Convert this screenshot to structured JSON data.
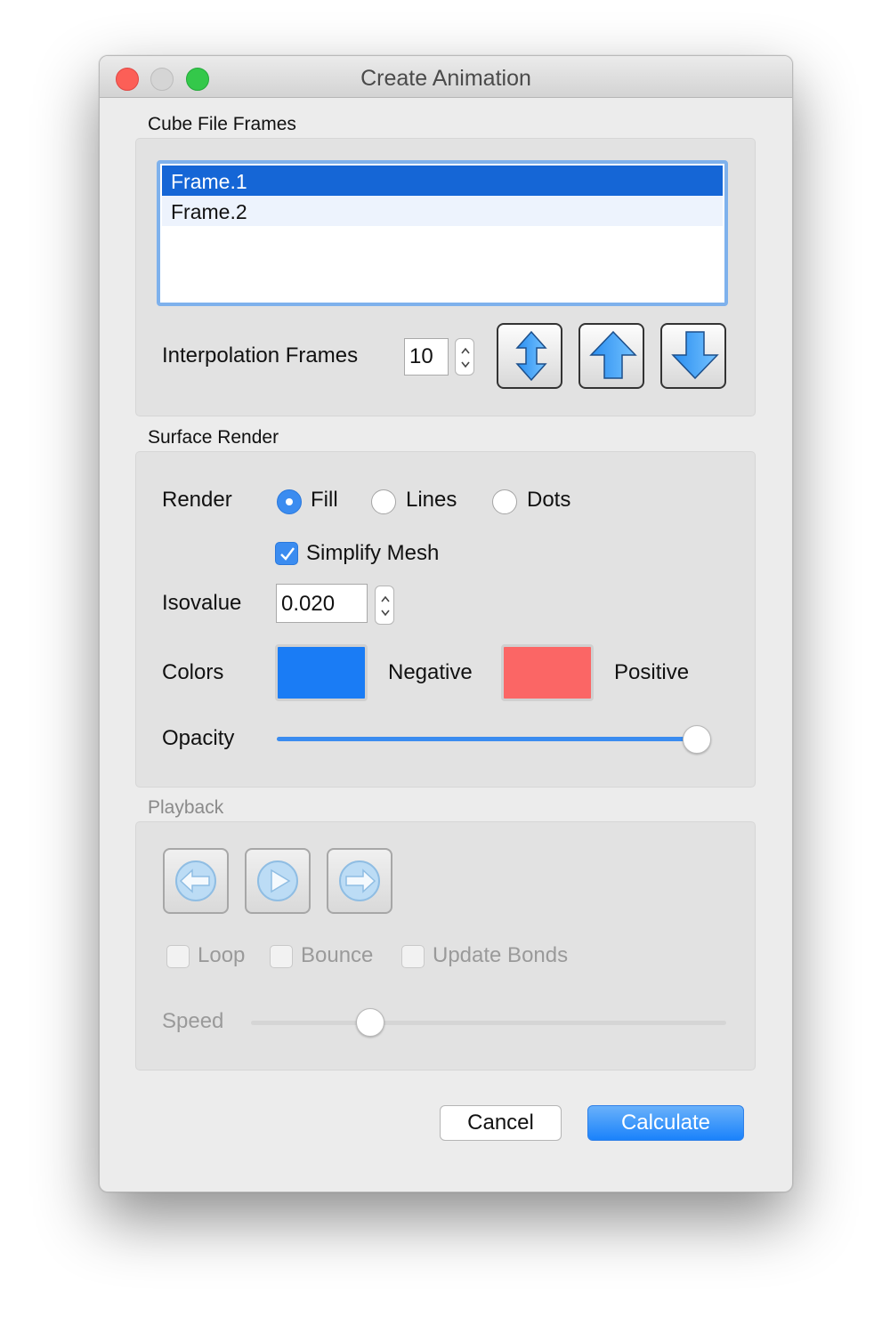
{
  "window": {
    "title": "Create Animation"
  },
  "cube_frames": {
    "group_label": "Cube File Frames",
    "frames": [
      "Frame.1",
      "Frame.2"
    ],
    "selected_index": 0,
    "interpolation_label": "Interpolation Frames",
    "interpolation_value": "10"
  },
  "surface": {
    "group_label": "Surface Render",
    "render_label": "Render",
    "render_options": [
      "Fill",
      "Lines",
      "Dots"
    ],
    "render_selected": "Fill",
    "simplify_mesh_label": "Simplify Mesh",
    "simplify_mesh_checked": true,
    "isovalue_label": "Isovalue",
    "isovalue": "0.020",
    "colors_label": "Colors",
    "negative_label": "Negative",
    "negative_color": "#1a7cf5",
    "positive_label": "Positive",
    "positive_color": "#fb6665",
    "opacity_label": "Opacity",
    "opacity_fraction": 1.0
  },
  "playback": {
    "group_label": "Playback",
    "loop_label": "Loop",
    "bounce_label": "Bounce",
    "update_bonds_label": "Update Bonds",
    "loop_checked": false,
    "bounce_checked": false,
    "update_bonds_checked": false,
    "speed_label": "Speed",
    "speed_fraction": 0.25
  },
  "icons": {
    "move_updown": "double-arrow-updown-icon",
    "move_up": "arrow-up-icon",
    "move_down": "arrow-down-icon",
    "prev": "arrow-left-circle-icon",
    "play": "play-circle-icon",
    "next": "arrow-right-circle-icon"
  },
  "buttons": {
    "cancel": "Cancel",
    "calculate": "Calculate"
  }
}
